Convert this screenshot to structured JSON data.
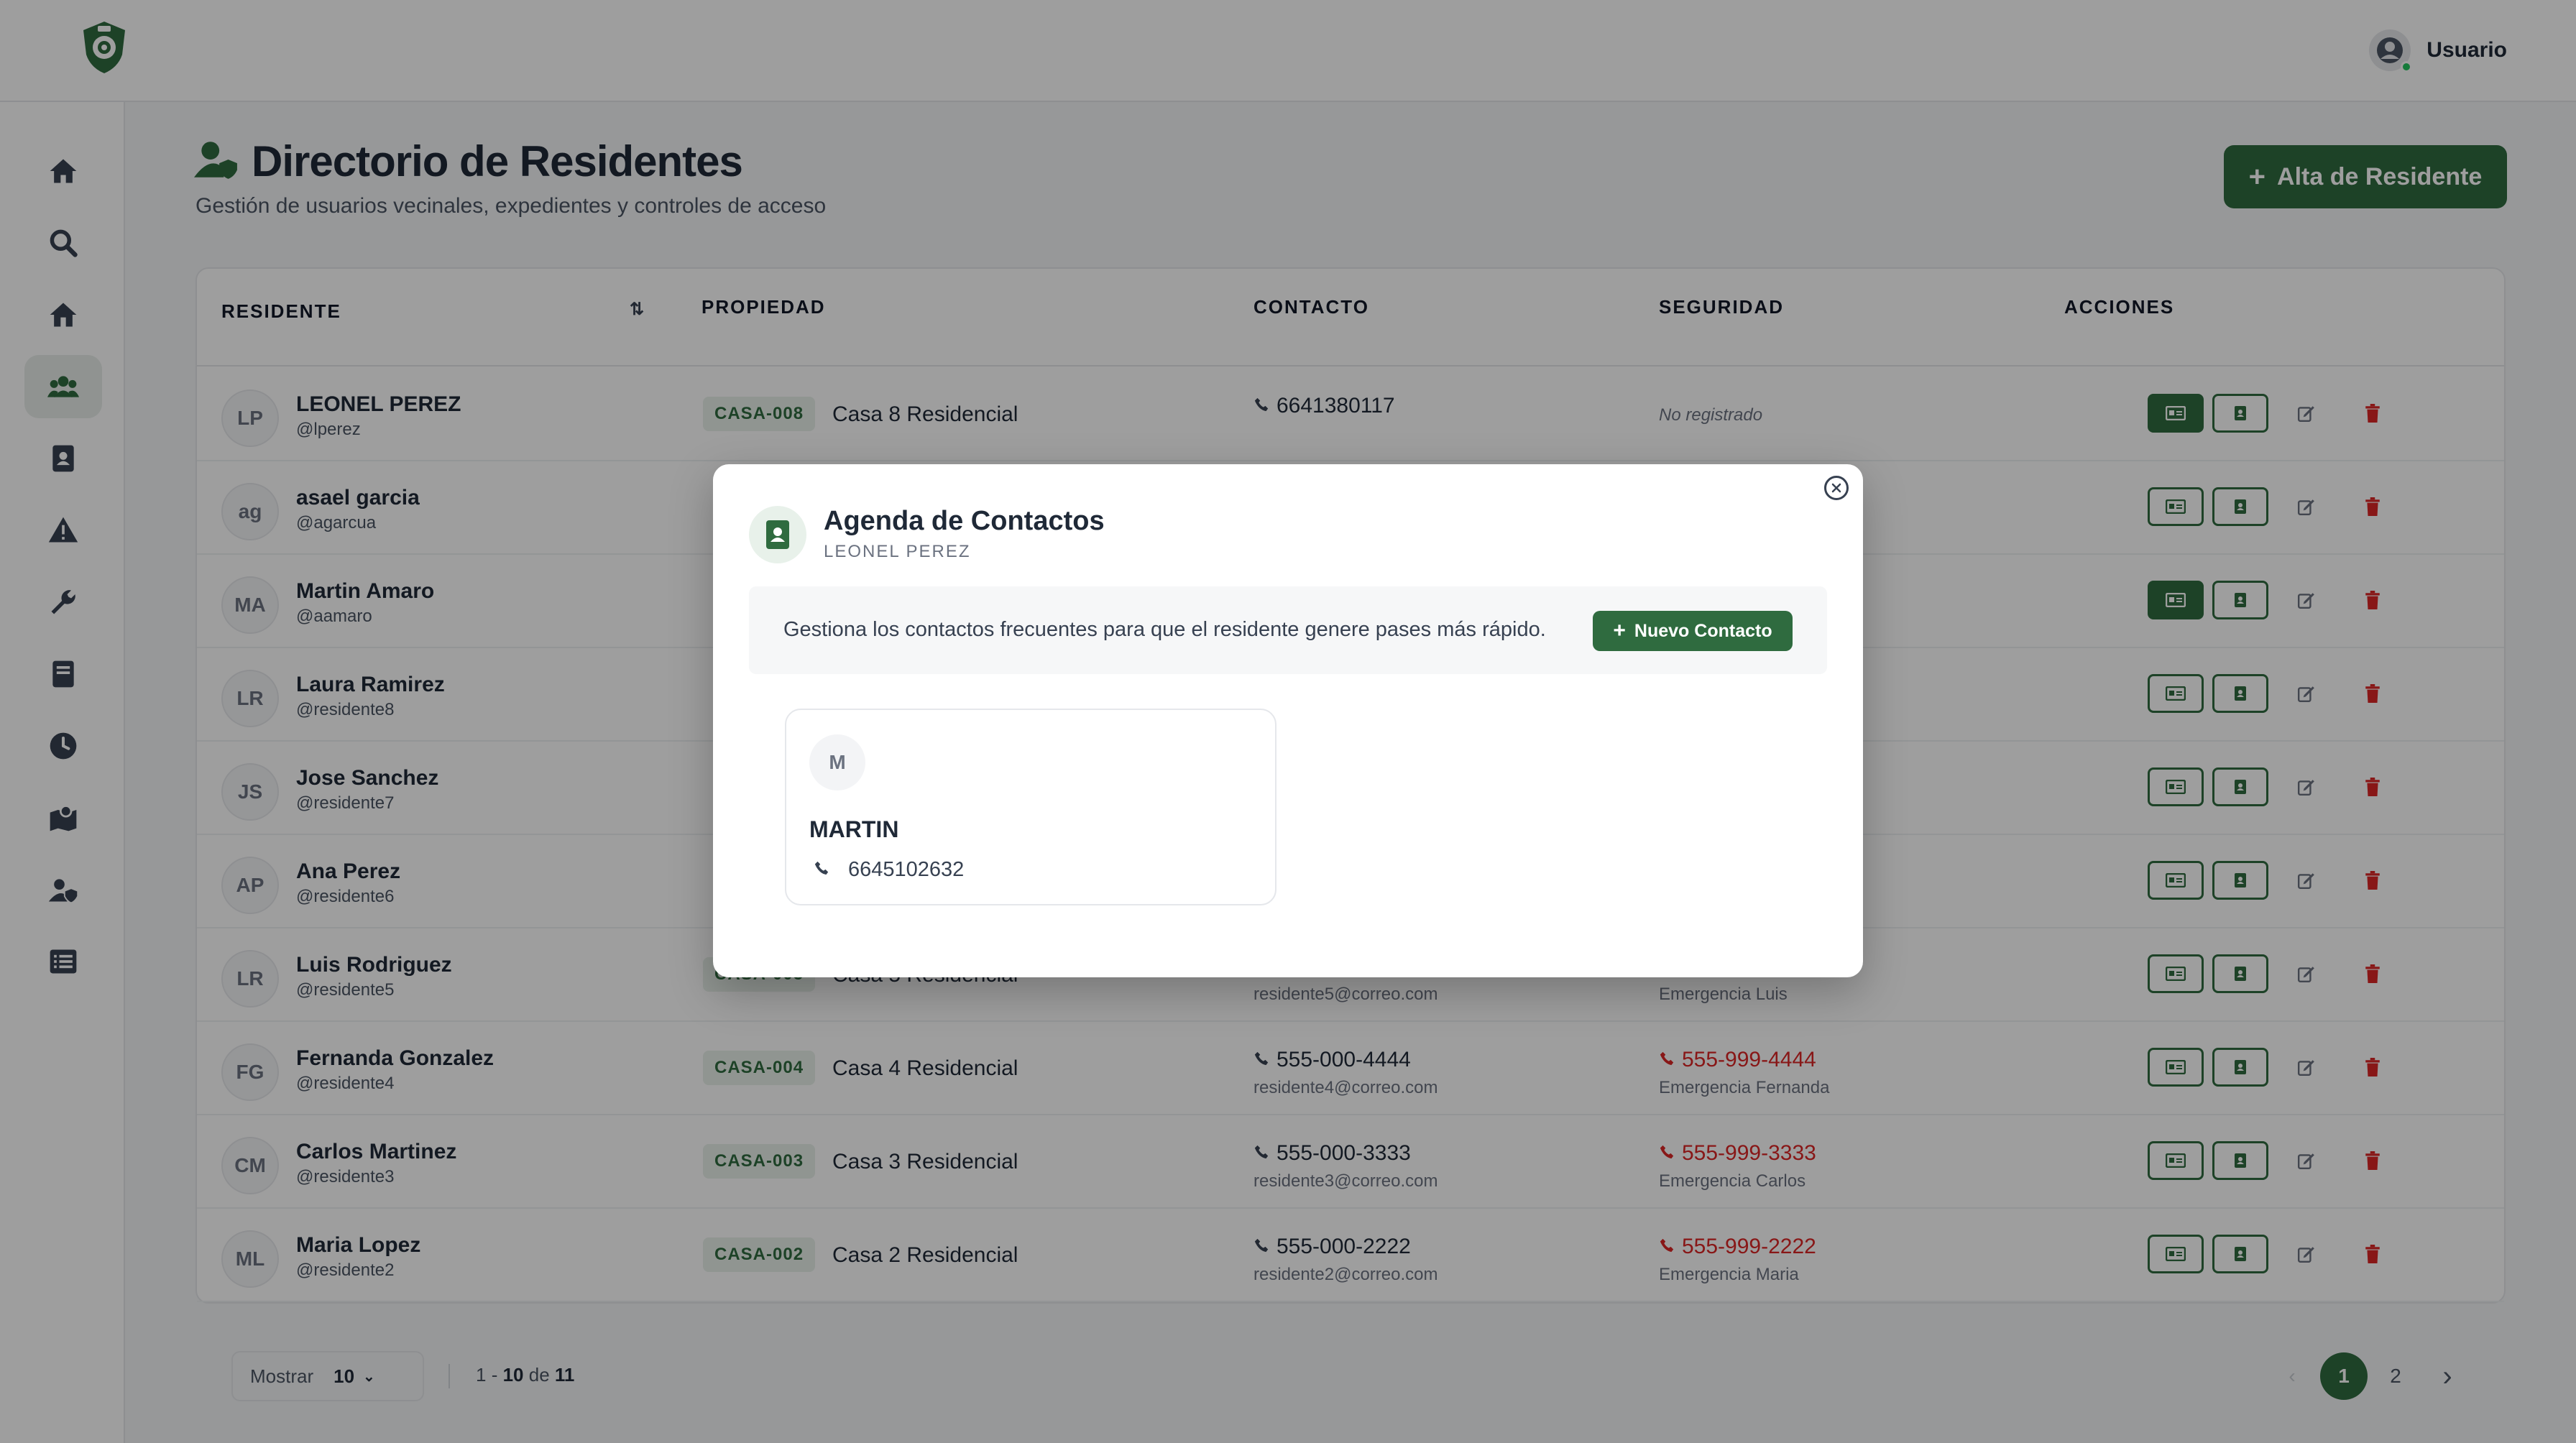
{
  "header": {
    "user_label": "Usuario"
  },
  "sidebar": {
    "items": [
      {
        "icon": "home-icon"
      },
      {
        "icon": "search-icon"
      },
      {
        "icon": "house-icon"
      },
      {
        "icon": "users-icon"
      },
      {
        "icon": "contact-book-icon"
      },
      {
        "icon": "alert-icon"
      },
      {
        "icon": "wrench-icon"
      },
      {
        "icon": "book-icon"
      },
      {
        "icon": "clock-icon"
      },
      {
        "icon": "map-icon"
      },
      {
        "icon": "user-shield-icon"
      },
      {
        "icon": "list-icon"
      }
    ]
  },
  "page": {
    "title": "Directorio de Residentes",
    "subtitle": "Gestión de usuarios vecinales, expedientes y controles de acceso",
    "add_button": "Alta de Residente"
  },
  "table": {
    "headers": {
      "resident": "RESIDENTE",
      "property": "PROPIEDAD",
      "contact": "CONTACTO",
      "security": "SEGURIDAD",
      "actions": "ACCIONES"
    },
    "rows": [
      {
        "initials": "LP",
        "name": "LEONEL PEREZ",
        "user": "@lperez",
        "code": "CASA-008",
        "property": "Casa 8 Residencial",
        "phone": "6641380117",
        "email": "",
        "emergency_phone": "",
        "emergency_contact": "",
        "security_note": "No registrado",
        "card_filled": true
      },
      {
        "initials": "ag",
        "name": "asael garcia",
        "user": "@agarcua",
        "code": "",
        "property": "",
        "phone": "",
        "email": "",
        "emergency_phone": "",
        "emergency_contact": "",
        "security_note": "",
        "card_filled": false
      },
      {
        "initials": "MA",
        "name": "Martin Amaro",
        "user": "@aamaro",
        "code": "",
        "property": "",
        "phone": "",
        "email": "",
        "emergency_phone": "",
        "emergency_contact": "",
        "security_note": "",
        "card_filled": true
      },
      {
        "initials": "LR",
        "name": "Laura Ramirez",
        "user": "@residente8",
        "code": "",
        "property": "",
        "phone": "",
        "email": "",
        "emergency_phone": "",
        "emergency_contact": "",
        "security_note": "",
        "card_filled": false
      },
      {
        "initials": "JS",
        "name": "Jose Sanchez",
        "user": "@residente7",
        "code": "",
        "property": "",
        "phone": "",
        "email": "",
        "emergency_phone": "",
        "emergency_contact": "",
        "security_note": "",
        "card_filled": false
      },
      {
        "initials": "AP",
        "name": "Ana Perez",
        "user": "@residente6",
        "code": "",
        "property": "",
        "phone": "",
        "email": "",
        "emergency_phone": "",
        "emergency_contact": "",
        "security_note": "",
        "card_filled": false
      },
      {
        "initials": "LR",
        "name": "Luis Rodriguez",
        "user": "@residente5",
        "code": "CASA-005",
        "property": "Casa 5 Residencial",
        "phone": "",
        "email": "residente5@correo.com",
        "emergency_phone": "",
        "emergency_contact": "Emergencia Luis",
        "security_note": "",
        "card_filled": false
      },
      {
        "initials": "FG",
        "name": "Fernanda Gonzalez",
        "user": "@residente4",
        "code": "CASA-004",
        "property": "Casa 4 Residencial",
        "phone": "555-000-4444",
        "email": "residente4@correo.com",
        "emergency_phone": "555-999-4444",
        "emergency_contact": "Emergencia Fernanda",
        "security_note": "",
        "card_filled": false
      },
      {
        "initials": "CM",
        "name": "Carlos Martinez",
        "user": "@residente3",
        "code": "CASA-003",
        "property": "Casa 3 Residencial",
        "phone": "555-000-3333",
        "email": "residente3@correo.com",
        "emergency_phone": "555-999-3333",
        "emergency_contact": "Emergencia Carlos",
        "security_note": "",
        "card_filled": false
      },
      {
        "initials": "ML",
        "name": "Maria Lopez",
        "user": "@residente2",
        "code": "CASA-002",
        "property": "Casa 2 Residencial",
        "phone": "555-000-2222",
        "email": "residente2@correo.com",
        "emergency_phone": "555-999-2222",
        "emergency_contact": "Emergencia Maria",
        "security_note": "",
        "card_filled": false
      }
    ]
  },
  "pagination": {
    "show_label": "Mostrar",
    "page_size": "10",
    "range_start": "1",
    "range_end": "10",
    "range_of": "de",
    "total": "11",
    "pages": [
      "1",
      "2"
    ],
    "current": "1"
  },
  "modal": {
    "title": "Agenda de Contactos",
    "subtitle": "LEONEL PEREZ",
    "info": "Gestiona los contactos frecuentes para que el residente genere pases más rápido.",
    "new_button": "Nuevo Contacto",
    "contacts": [
      {
        "initial": "M",
        "name": "MARTIN",
        "phone": "6645102632"
      }
    ]
  },
  "colors": {
    "primary": "#2f6b3f",
    "danger": "#dc2626",
    "badge_bg": "#e8f1ea"
  }
}
